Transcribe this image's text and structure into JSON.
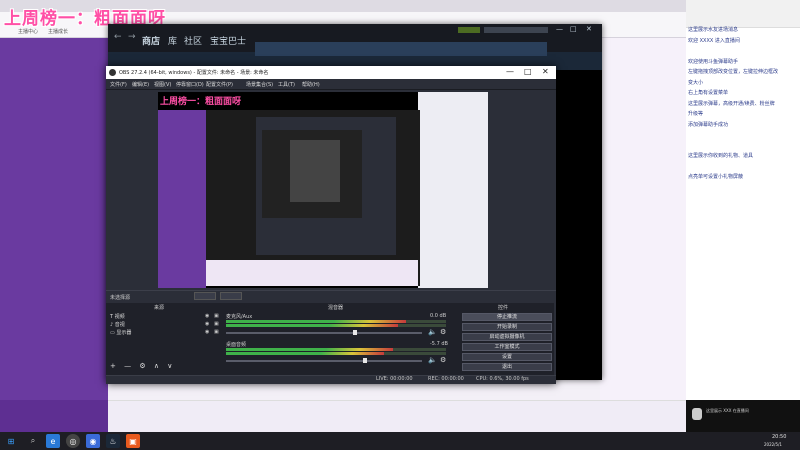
{
  "overlay_title": "上周榜一：粗面面呀",
  "browser": {
    "bookmarks": [
      "主播中心",
      "主播成长"
    ]
  },
  "steam": {
    "nav": [
      "商店",
      "库",
      "社区",
      "宝宝巴士"
    ]
  },
  "obs": {
    "title": "OBS 27.2.4 (64-bit, windows) - 配置文件: 未命名 - 场景: 未命名",
    "menu": [
      "文件(F)",
      "编辑(E)",
      "视图(V)",
      "停靠窗口(D)",
      "配置文件(P)",
      "场景集合(S)",
      "工具(T)",
      "帮助(H)"
    ],
    "preview_overlay": "上周榜一：粗面面呀",
    "docks": {
      "scenes_label": "来源",
      "mixer_label": "混音器",
      "controls_label": "控件",
      "source_bar_label": "未选择源"
    },
    "sources": [
      {
        "name": "视频",
        "icon": "text-t-icon"
      },
      {
        "name": "音视",
        "icon": "music-note-icon"
      },
      {
        "name": "显示器",
        "icon": "monitor-icon"
      }
    ],
    "mixer": [
      {
        "name": "麦克风/Aux",
        "db": "0.0 dB",
        "level": 0.82,
        "volume": 0.65
      },
      {
        "name": "桌面音频",
        "db": "-5.7 dB",
        "level": 0.76,
        "volume": 0.7
      }
    ],
    "controls": [
      "停止推流",
      "开始录制",
      "启动虚拟摄像机",
      "工作室模式",
      "设置",
      "退出"
    ],
    "status": {
      "live": "LIVE: 00:00:00",
      "rec": "REC: 00:00:00",
      "cpu": "CPU: 0.6%, 30.00 fps"
    },
    "bottom_toolbar": [
      "+",
      "—",
      "⚙",
      "∧",
      "∨"
    ]
  },
  "right_panel": {
    "lines": [
      "这里展示水友进场消息",
      "欢迎 XXXX 进入直播间",
      "",
      "欢迎使用斗鱼弹幕助手",
      "左键拖拽顶部改变位置，左键拉伸边框改",
      "变大小",
      "右上角有设置菜单",
      "这里展示弹幕，高级开通/续费、粉丝牌",
      "升级等",
      "添加弹幕助手成功",
      "",
      "",
      "这里展示你收到的礼物、道具",
      "",
      "点亮单可设置小礼物屏蔽"
    ]
  },
  "notification": "这里展示 XXX 在直播间",
  "taskbar": {
    "time": "20:50",
    "date": "2022/5/1"
  }
}
